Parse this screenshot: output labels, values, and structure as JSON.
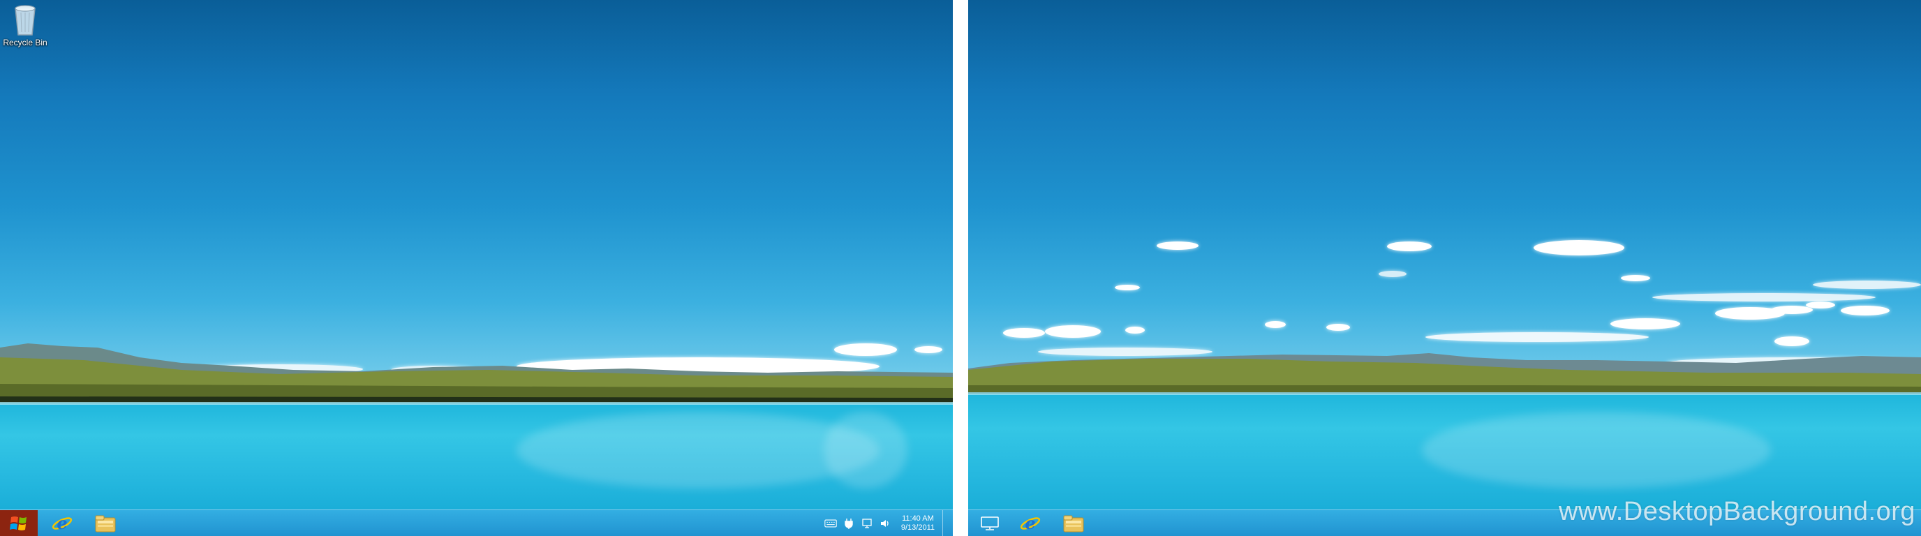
{
  "desktop": {
    "icons": [
      {
        "label": "Recycle Bin",
        "icon": "recycle-bin-icon"
      }
    ]
  },
  "taskbar_left": {
    "start_icon": "windows-logo-icon",
    "pinned": [
      {
        "name": "Internet Explorer",
        "icon": "internet-explorer-icon"
      },
      {
        "name": "File Explorer",
        "icon": "file-explorer-folder-icon"
      }
    ],
    "tray": {
      "icons": [
        "keyboard-icon",
        "power-plug-icon",
        "network-icon",
        "volume-icon"
      ],
      "time": "11:40 AM",
      "date": "9/13/2011"
    }
  },
  "taskbar_right": {
    "show_desktop_icon": "desktop-monitor-icon",
    "pinned": [
      {
        "name": "Internet Explorer",
        "icon": "internet-explorer-icon"
      },
      {
        "name": "File Explorer",
        "icon": "file-explorer-folder-icon"
      }
    ]
  },
  "watermark": "www.DesktopBackground.org",
  "colors": {
    "sky_top": "#0a5e98",
    "sky_bottom": "#6fcaea",
    "lake": "#26b8df",
    "taskbar": "#1e9ad6",
    "start_button": "#8c2410"
  }
}
